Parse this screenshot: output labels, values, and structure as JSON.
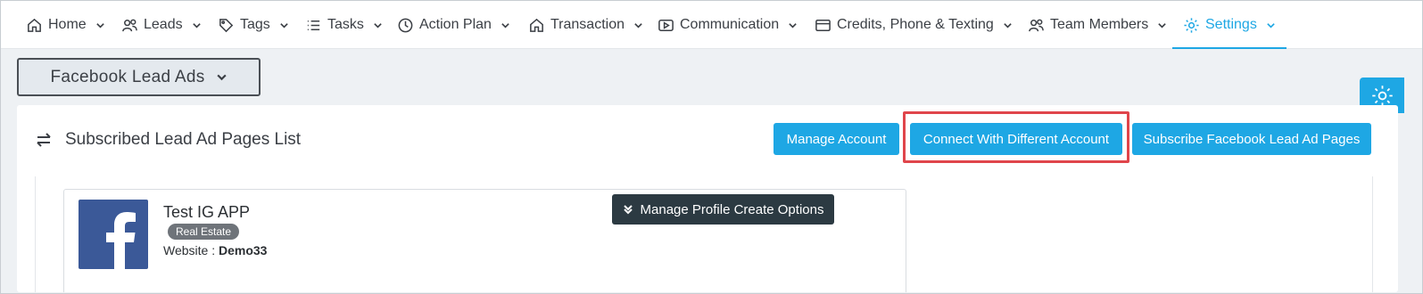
{
  "nav": {
    "items": [
      {
        "label": "Home",
        "icon": "home-icon"
      },
      {
        "label": "Leads",
        "icon": "users-icon"
      },
      {
        "label": "Tags",
        "icon": "tag-icon"
      },
      {
        "label": "Tasks",
        "icon": "list-icon"
      },
      {
        "label": "Action Plan",
        "icon": "clock-icon"
      },
      {
        "label": "Transaction",
        "icon": "house-icon"
      },
      {
        "label": "Communication",
        "icon": "play-icon"
      },
      {
        "label": "Credits, Phone & Texting",
        "icon": "card-icon"
      },
      {
        "label": "Team Members",
        "icon": "users-icon"
      },
      {
        "label": "Settings",
        "icon": "gear-icon",
        "active": true
      }
    ]
  },
  "dropdown": {
    "label": "Facebook Lead Ads"
  },
  "card": {
    "title": "Subscribed Lead Ad Pages List",
    "buttons": {
      "manage_account": "Manage Account",
      "connect_different": "Connect With Different Account",
      "subscribe": "Subscribe Facebook Lead Ad Pages"
    }
  },
  "page": {
    "name": "Test IG APP",
    "category": "Real Estate",
    "website_label": "Website :",
    "website_value": "Demo33",
    "manage_options": "Manage Profile Create Options"
  },
  "colors": {
    "accent": "#1ea7e4",
    "highlight": "#e0454b",
    "facebook": "#3b5998"
  }
}
